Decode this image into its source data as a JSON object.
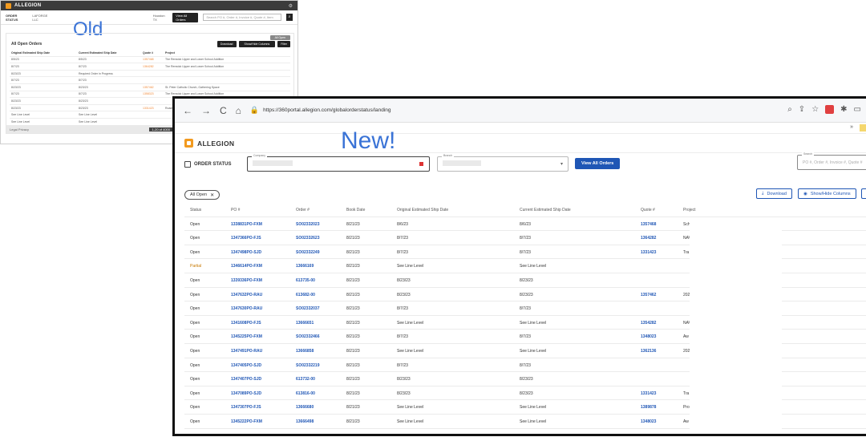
{
  "labels": {
    "old": "Old",
    "new": "New!"
  },
  "old_screen": {
    "brand": "ALLEGION",
    "tag": "ORDER STATUS",
    "company": "LAFORGE LLC",
    "location": "Houston TX",
    "view_btn": "View All Orders",
    "search_placeholder": "Search PO #, Order #, Invoice #, Quote #, Item",
    "panel_title": "All Open Orders",
    "buttons": [
      "Download",
      "Show/Hide Columns",
      "Filter"
    ],
    "chip": "All Open",
    "headers": [
      "Original Estimated Ship Date",
      "Current Estimated Ship Date",
      "Quote #",
      "Project"
    ],
    "rows": [
      [
        "8/5/23",
        "8/5/23",
        "1357468",
        "The Renwick Upper and Lower School Addition"
      ],
      [
        "8/7/23",
        "8/7/23",
        "1364282",
        "The Renwick Upper and Lower School Addition"
      ],
      [
        "8/23/23",
        "Required Order in Progress",
        "",
        ""
      ],
      [
        "8/7/23",
        "8/7/23",
        "",
        ""
      ],
      [
        "8/23/23",
        "8/23/23",
        "1357462",
        "St. Peter Catholic Church, Gathering Space"
      ],
      [
        "8/7/23",
        "8/7/23",
        "1358323",
        "The Renwick Upper and Lower School Addition"
      ],
      [
        "8/23/23",
        "8/23/23",
        "",
        ""
      ],
      [
        "8/23/23",
        "8/23/23",
        "1331423",
        "Roads"
      ],
      [
        "See Line Level",
        "See Line Level",
        "",
        ""
      ],
      [
        "See Line Level",
        "See Line Level",
        "",
        ""
      ]
    ],
    "footer": "Legal Privacy",
    "pager": "1-20 of 4000"
  },
  "browser": {
    "url": "https://360portal.allegion.com/globalorderstatus/landing",
    "nav": [
      "←",
      "→",
      "C",
      "⌂"
    ],
    "overflow": "»"
  },
  "app": {
    "brand": "ALLEGION",
    "page_title": "ORDER STATUS",
    "company_label": "Company",
    "branch_label": "Branch",
    "view_all": "View All Orders",
    "search_label": "Search",
    "search_placeholder": "PO #, Order #, Invoice #, Quote #",
    "chip": "All Open",
    "chip_close": "✕",
    "download": "Download",
    "show_hide": "Show/Hide Columns",
    "download_icon": "⤓",
    "showhide_icon": "◉"
  },
  "table": {
    "headers": [
      "Status",
      "PO #",
      "Order #",
      "Book Date",
      "Original Estimated Ship Date",
      "Current Estimated Ship Date",
      "Quote #",
      "Project"
    ],
    "rows": [
      [
        "Open",
        "1338831PO-FXM",
        "SO02332023",
        "8/21/23",
        "8/6/23",
        "8/6/23",
        "1357468",
        "Sch"
      ],
      [
        "Open",
        "1347366PO-FJS",
        "SO02332623",
        "8/21/23",
        "8/7/23",
        "8/7/23",
        "1364282",
        "NAV"
      ],
      [
        "Open",
        "1347498PO-SJD",
        "SO02332249",
        "8/21/23",
        "8/7/23",
        "8/7/23",
        "1331423",
        "Tra"
      ],
      [
        "Partial",
        "1346614PO-FXM",
        "13666169",
        "8/21/23",
        "See Line Level",
        "See Line Level",
        "",
        ""
      ],
      [
        "Open",
        "1339336PO-FXM",
        "613735-00",
        "8/21/23",
        "8/23/23",
        "8/23/23",
        "",
        ""
      ],
      [
        "Open",
        "1347632PO-RAU",
        "613682-00",
        "8/21/23",
        "8/23/23",
        "8/23/23",
        "1357462",
        "202"
      ],
      [
        "Open",
        "1347630PO-RAU",
        "SO02332037",
        "8/21/23",
        "8/7/23",
        "8/7/23",
        "",
        ""
      ],
      [
        "Open",
        "1341608PO-FJS",
        "13666651",
        "8/21/23",
        "See Line Level",
        "See Line Level",
        "1354282",
        "NAV"
      ],
      [
        "Open",
        "1345225PO-FXM",
        "SO02332466",
        "8/21/23",
        "8/7/23",
        "8/7/23",
        "1348023",
        "Aw"
      ],
      [
        "Open",
        "1347491PO-RAU",
        "13666858",
        "8/21/23",
        "See Line Level",
        "See Line Level",
        "1362136",
        "202"
      ],
      [
        "Open",
        "1347405PO-SJD",
        "SO02332219",
        "8/21/23",
        "8/7/23",
        "8/7/23",
        "",
        ""
      ],
      [
        "Open",
        "1347407PO-SJD",
        "613732-00",
        "8/21/23",
        "8/23/23",
        "8/23/23",
        "",
        ""
      ],
      [
        "Open",
        "1347089PO-SJD",
        "613816-00",
        "8/21/23",
        "8/23/23",
        "8/23/23",
        "1331423",
        "Tra"
      ],
      [
        "Open",
        "1347307PO-FJS",
        "13666680",
        "8/21/23",
        "See Line Level",
        "See Line Level",
        "1389878",
        "Pro"
      ],
      [
        "Open",
        "1345222PO-FXM",
        "13666498",
        "8/21/23",
        "See Line Level",
        "See Line Level",
        "1348023",
        "Aw"
      ]
    ]
  }
}
